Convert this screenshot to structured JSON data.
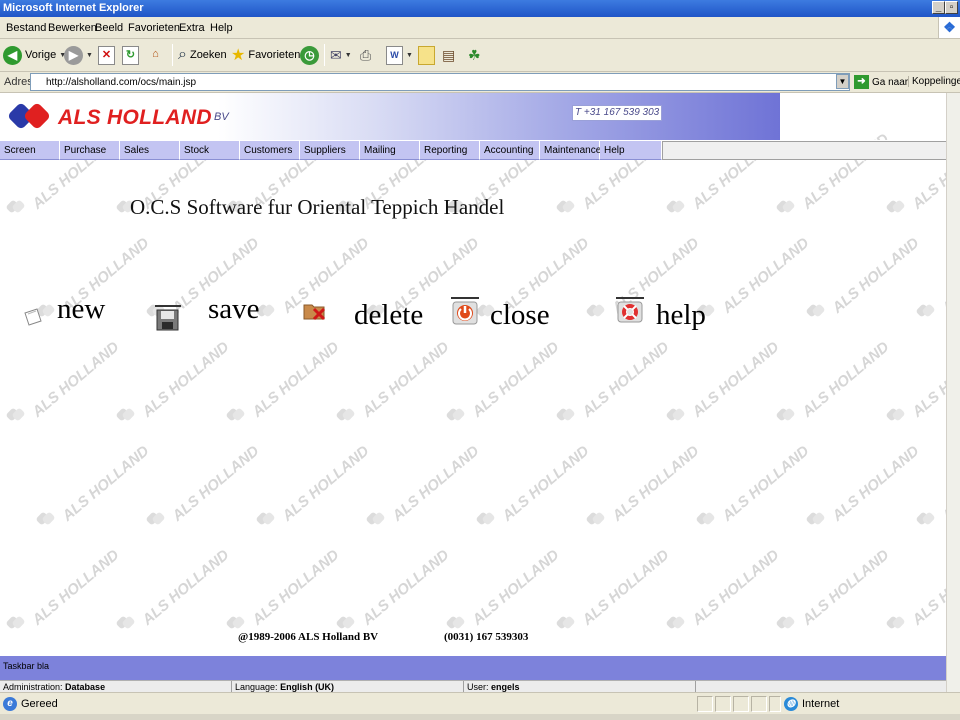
{
  "window": {
    "title": "Microsoft Internet Explorer"
  },
  "menu": [
    "Bestand",
    "Bewerken",
    "Beeld",
    "Favorieten",
    "Extra",
    "Help"
  ],
  "toolbar": {
    "back": "Vorige",
    "search": "Zoeken",
    "favorites": "Favorieten"
  },
  "address": {
    "label": "Adres",
    "url": "http://alsholland.com/ocs/main.jsp",
    "go": "Ga naar",
    "links": "Koppelingen"
  },
  "banner": {
    "logo_text": "ALS HOLLAND",
    "logo_suffix": "BV",
    "phone": "T +31 167 539 303"
  },
  "nav": [
    "Screen",
    "Purchase",
    "Sales",
    "Stock",
    "Customers",
    "Suppliers",
    "Mailing",
    "Reporting",
    "Accounting",
    "Maintenance",
    "Help"
  ],
  "heading": "O.C.S Software fur Oriental Teppich Handel",
  "actions": {
    "new": "new",
    "save": "save",
    "delete": "delete",
    "close": "close",
    "help": "help"
  },
  "watermark_text": "ALS HOLLAND",
  "footer": {
    "copyright": "@1989-2006 ALS Holland BV",
    "phone": "(0031) 167 539303"
  },
  "taskbar": {
    "label": "Taskbar bla"
  },
  "info": {
    "admin_label": "Administration:",
    "admin_value": "Database",
    "lang_label": "Language:",
    "lang_value": "English (UK)",
    "user_label": "User:",
    "user_value": "engels"
  },
  "status": {
    "text": "Gereed",
    "zone": "Internet"
  },
  "colors": {
    "brand_red": "#e02020",
    "brand_blue": "#2a3aa8",
    "nav_bg": "#c3c4f2",
    "taskbar_bg": "#7d82db"
  }
}
